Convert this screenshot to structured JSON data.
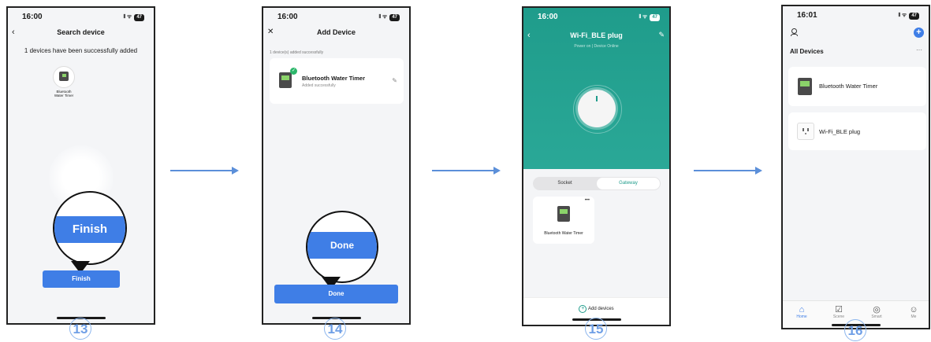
{
  "steps": [
    "13",
    "14",
    "15",
    "16"
  ],
  "screen13": {
    "time": "16:00",
    "signal": "𝍪 ᯤ",
    "battery": "47",
    "back_icon": "chevron-left-icon",
    "title": "Search device",
    "message": "1 devices have been successfully added",
    "device_label": "Bluetooth Water Timer",
    "zoom_label": "Finish",
    "button_label": "Finish"
  },
  "screen14": {
    "time": "16:00",
    "signal": "𝍪 ᯤ",
    "battery": "47",
    "close_icon": "close-icon",
    "title": "Add Device",
    "subtitle": "1 device(s) added successfully",
    "device_name": "Bluetooth Water Timer",
    "device_status": "Added successfully",
    "zoom_label": "Done",
    "button_label": "Done"
  },
  "screen15": {
    "time": "16:00",
    "signal": "𝍪 ᯤ",
    "battery": "47",
    "title": "Wi-Fi_BLE plug",
    "status": "Power on | Device Online",
    "tabs": [
      "Socket",
      "Gateway"
    ],
    "active_tab": "Gateway",
    "subdevice_name": "Bluetooth Water Timer",
    "more_label": "•••",
    "add_label": "Add devices",
    "accent": "#1f9c8b"
  },
  "screen16": {
    "time": "16:01",
    "signal": "𝍪 ᯤ",
    "battery": "47",
    "section_title": "All Devices",
    "more_label": "···",
    "devices": [
      "Bluetooth Water Timer",
      "Wi-Fi_BLE plug"
    ],
    "tabs": [
      {
        "label": "Home",
        "icon": "home-icon"
      },
      {
        "label": "Scene",
        "icon": "scene-icon"
      },
      {
        "label": "Smart",
        "icon": "smart-icon"
      },
      {
        "label": "Me",
        "icon": "me-icon"
      }
    ]
  }
}
